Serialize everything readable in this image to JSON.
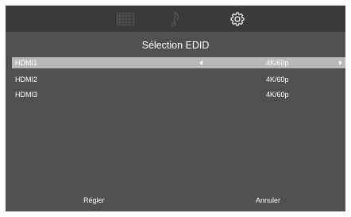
{
  "topbar": {
    "icons": [
      "picture-grid-icon",
      "music-note-icon",
      "settings-gear-icon"
    ],
    "active_icon": "settings-gear-icon"
  },
  "title": "Sélection EDID",
  "rows": [
    {
      "label": "HDMI1",
      "value": "4K/60p",
      "selected": true
    },
    {
      "label": "HDMI2",
      "value": "4K/60p",
      "selected": false
    },
    {
      "label": "HDMI3",
      "value": "4K/60p",
      "selected": false
    }
  ],
  "footer": {
    "set_label": "Régler",
    "cancel_label": "Annuler"
  },
  "colors": {
    "background": "#505050",
    "topbar": "#3a3a3a",
    "selection": "#b9b9b9",
    "text": "#ffffff"
  }
}
